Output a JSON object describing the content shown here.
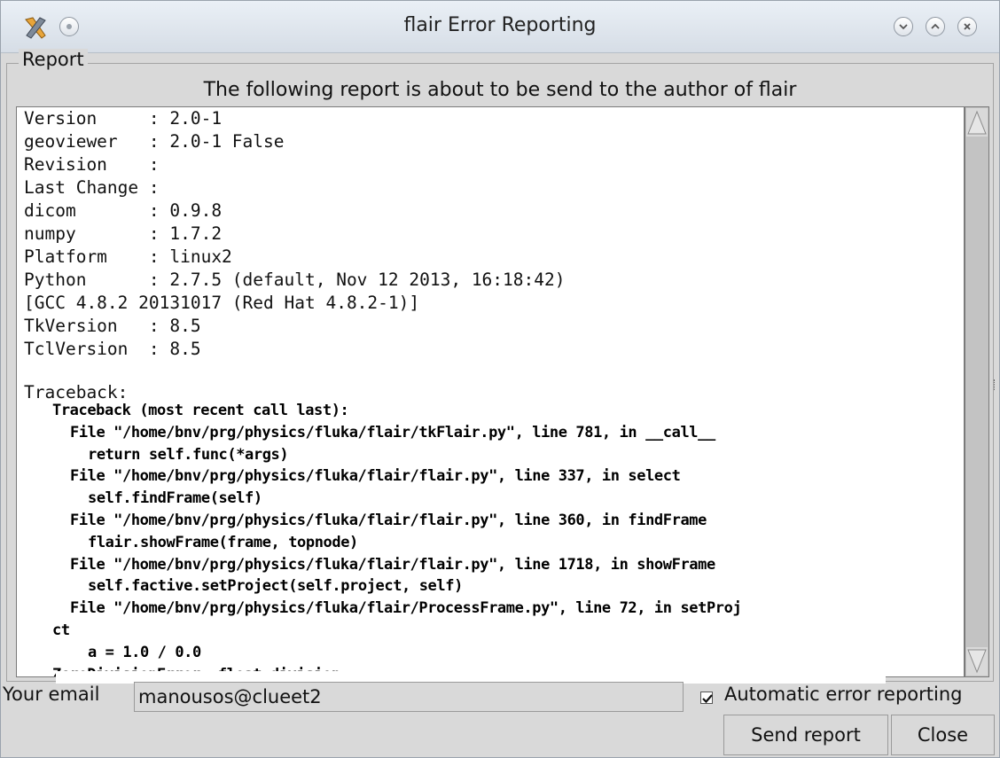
{
  "window": {
    "title": "flair Error Reporting"
  },
  "report": {
    "group_label": "Report",
    "header": "The following report is about to be send to the author of flair",
    "version_lines": [
      "Version     : 2.0-1",
      "geoviewer   : 2.0-1 False",
      "Revision    :",
      "Last Change :",
      "dicom       : 0.9.8",
      "numpy       : 1.7.2",
      "Platform    : linux2",
      "Python      : 2.7.5 (default, Nov 12 2013, 16:18:42)",
      "[GCC 4.8.2 20131017 (Red Hat 4.8.2-1)]",
      "TkVersion   : 8.5",
      "TclVersion  : 8.5"
    ],
    "traceback_label": "Traceback:",
    "traceback_lines": [
      "Traceback (most recent call last):",
      "File \"/home/bnv/prg/physics/fluka/flair/tkFlair.py\", line 781, in __call__",
      "return self.func(*args)",
      "File \"/home/bnv/prg/physics/fluka/flair/flair.py\", line 337, in select",
      "self.findFrame(self)",
      "File \"/home/bnv/prg/physics/fluka/flair/flair.py\", line 360, in findFrame",
      "flair.showFrame(frame, topnode)",
      "File \"/home/bnv/prg/physics/fluka/flair/flair.py\", line 1718, in showFrame",
      "self.factive.setProject(self.project, self)",
      "File \"/home/bnv/prg/physics/fluka/flair/ProcessFrame.py\", line 72, in setProj",
      "ct",
      "a = 1.0 / 0.0",
      "ZeroDivisionError: float division"
    ]
  },
  "email": {
    "label": "Your email",
    "value": "manousos@clueet2"
  },
  "auto_report": {
    "label": "Automatic error reporting",
    "checked": true
  },
  "buttons": {
    "send": "Send report",
    "close": "Close"
  }
}
